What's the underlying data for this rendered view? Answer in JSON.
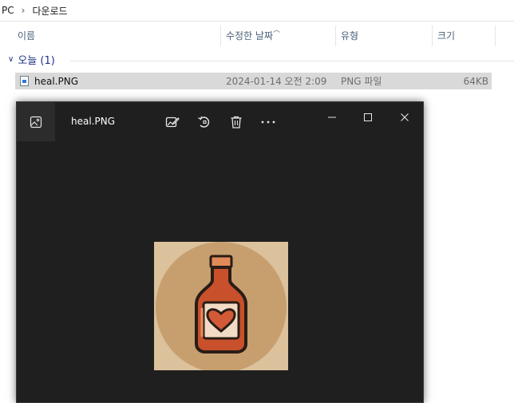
{
  "explorer": {
    "breadcrumb": [
      "PC",
      "다운로드"
    ],
    "columns": {
      "name": "이름",
      "date": "수정한 날짜",
      "type": "유형",
      "size": "크기"
    },
    "group": {
      "label": "오늘 (1)"
    },
    "files": [
      {
        "name": "heal.PNG",
        "date": "2024-01-14 오전 2:09",
        "type": "PNG 파일",
        "size": "64KB"
      }
    ]
  },
  "viewer": {
    "title": "heal.PNG",
    "toolbar_icons": [
      "edit-image-icon",
      "rotate-icon",
      "delete-icon",
      "more-icon"
    ],
    "window_controls": [
      "minimize-icon",
      "maximize-icon",
      "close-icon"
    ],
    "image_subject": "potion-bottle-heart"
  }
}
